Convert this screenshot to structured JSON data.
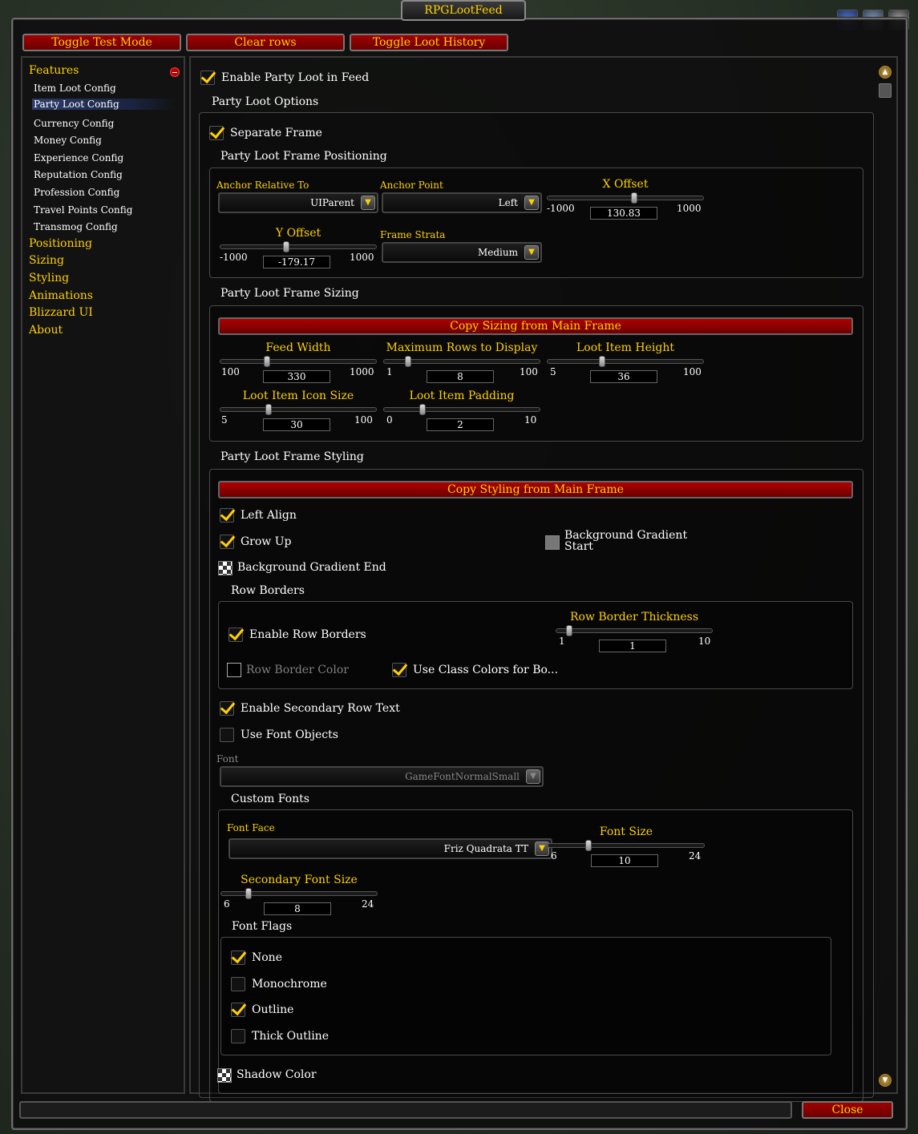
{
  "window_title": "RPGLootFeed",
  "toolbar": {
    "toggle_test_mode": "Toggle Test Mode",
    "clear_rows": "Clear rows",
    "toggle_loot_history": "Toggle Loot History"
  },
  "sidebar": {
    "items": [
      {
        "label": "Features",
        "level": "top"
      },
      {
        "label": "Item Loot Config",
        "level": "sub"
      },
      {
        "label": "Party Loot Config",
        "level": "sub",
        "selected": true
      },
      {
        "label": "Currency Config",
        "level": "sub"
      },
      {
        "label": "Money Config",
        "level": "sub"
      },
      {
        "label": "Experience Config",
        "level": "sub"
      },
      {
        "label": "Reputation Config",
        "level": "sub"
      },
      {
        "label": "Profession Config",
        "level": "sub"
      },
      {
        "label": "Travel Points Config",
        "level": "sub"
      },
      {
        "label": "Transmog Config",
        "level": "sub"
      },
      {
        "label": "Positioning",
        "level": "top"
      },
      {
        "label": "Sizing",
        "level": "top"
      },
      {
        "label": "Styling",
        "level": "top"
      },
      {
        "label": "Animations",
        "level": "top"
      },
      {
        "label": "Blizzard UI",
        "level": "top"
      },
      {
        "label": "About",
        "level": "top"
      }
    ]
  },
  "main": {
    "enable_party_loot": "Enable Party Loot in Feed",
    "party_loot_options": "Party Loot Options",
    "separate_frame": "Separate Frame",
    "positioning": {
      "heading": "Party Loot Frame Positioning",
      "anchor_relative_label": "Anchor Relative To",
      "anchor_relative_value": "UIParent",
      "anchor_point_label": "Anchor Point",
      "anchor_point_value": "Left",
      "x_offset": {
        "label": "X Offset",
        "min": "-1000",
        "max": "1000",
        "value": "130.83"
      },
      "y_offset": {
        "label": "Y Offset",
        "min": "-1000",
        "max": "1000",
        "value": "-179.17"
      },
      "frame_strata_label": "Frame Strata",
      "frame_strata_value": "Medium"
    },
    "sizing": {
      "heading": "Party Loot Frame Sizing",
      "copy_button": "Copy Sizing from Main Frame",
      "feed_width": {
        "label": "Feed Width",
        "min": "100",
        "max": "1000",
        "value": "330"
      },
      "max_rows": {
        "label": "Maximum Rows to Display",
        "min": "1",
        "max": "100",
        "value": "8"
      },
      "item_height": {
        "label": "Loot Item Height",
        "min": "5",
        "max": "100",
        "value": "36"
      },
      "icon_size": {
        "label": "Loot Item Icon Size",
        "min": "5",
        "max": "100",
        "value": "30"
      },
      "padding": {
        "label": "Loot Item Padding",
        "min": "0",
        "max": "10",
        "value": "2"
      }
    },
    "styling": {
      "heading": "Party Loot Frame Styling",
      "copy_button": "Copy Styling from Main Frame",
      "left_align": "Left Align",
      "grow_up": "Grow Up",
      "bg_gradient_start": "Background Gradient Start",
      "bg_gradient_end": "Background Gradient End",
      "row_borders_heading": "Row Borders",
      "enable_row_borders": "Enable Row Borders",
      "row_border_thickness": {
        "label": "Row Border Thickness",
        "min": "1",
        "max": "10",
        "value": "1"
      },
      "row_border_color": "Row Border Color",
      "use_class_colors": "Use Class Colors for Bo...",
      "enable_secondary_text": "Enable Secondary Row Text",
      "use_font_objects": "Use Font Objects",
      "font_label": "Font",
      "font_value": "GameFontNormalSmall",
      "custom_fonts_heading": "Custom Fonts",
      "font_face_label": "Font Face",
      "font_face_value": "Friz Quadrata TT",
      "font_size": {
        "label": "Font Size",
        "min": "6",
        "max": "24",
        "value": "10"
      },
      "secondary_font_size": {
        "label": "Secondary Font Size",
        "min": "6",
        "max": "24",
        "value": "8"
      },
      "font_flags_heading": "Font Flags",
      "flag_none": "None",
      "flag_monochrome": "Monochrome",
      "flag_outline": "Outline",
      "flag_thick_outline": "Thick Outline",
      "shadow_color": "Shadow Color"
    }
  },
  "footer": {
    "close": "Close"
  },
  "colors": {
    "accent_gold": "#ffd100",
    "button_red": "#8a0000",
    "background": "#0e0e0e"
  }
}
